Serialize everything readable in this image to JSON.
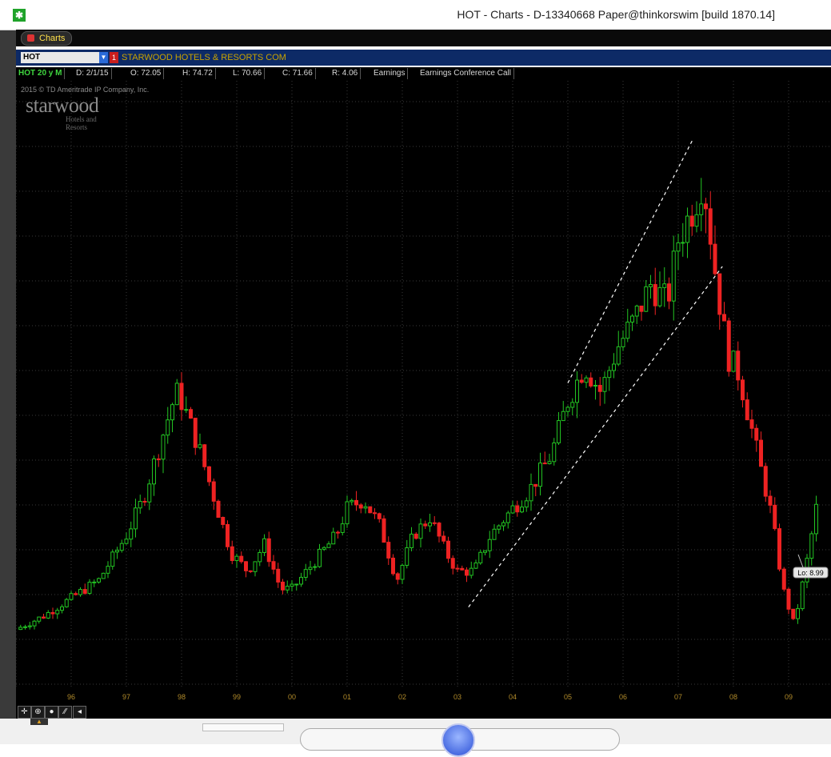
{
  "window": {
    "title": "HOT - Charts - D-13340668 Paper@thinkorswim [build 1870.14]"
  },
  "tab": {
    "label": "Charts"
  },
  "symbol": {
    "value": "HOT",
    "flag": "1",
    "company": "STARWOOD HOTELS & RESORTS COM"
  },
  "info": {
    "series": "HOT 20 y M",
    "date": "D: 2/1/15",
    "open": "O: 72.05",
    "high": "H: 74.72",
    "low": "L: 70.66",
    "close": "C: 71.66",
    "range": "R: 4.06",
    "earnings": "Earnings",
    "conference": "Earnings Conference Call"
  },
  "watermark": {
    "copyright": "2015 © TD Ameritrade IP Company, Inc.",
    "logo": "starwood",
    "logo_sub_1": "Hotels and",
    "logo_sub_2": "Resorts"
  },
  "colors": {
    "up": "#22c422",
    "down": "#ee2222",
    "axis_label": "#b08a2a",
    "grid": "#3a3a3a",
    "channel": "#ffffff"
  },
  "chart_data": {
    "type": "candlestick",
    "x_tick_labels": [
      "96",
      "97",
      "98",
      "99",
      "00",
      "01",
      "02",
      "03",
      "04",
      "05",
      "06",
      "07",
      "08",
      "09"
    ],
    "low_annotation": "Lo: 8.99",
    "ylim": [
      0,
      80
    ],
    "close_path": [
      [
        "1995.0",
        9.5
      ],
      [
        "1995.5",
        11
      ],
      [
        "1996.0",
        13
      ],
      [
        "1996.5",
        15
      ],
      [
        "1997.0",
        20
      ],
      [
        "1997.3",
        24
      ],
      [
        "1997.6",
        30
      ],
      [
        "1997.9",
        36
      ],
      [
        "1998.0",
        35
      ],
      [
        "1998.3",
        30
      ],
      [
        "1998.6",
        24
      ],
      [
        "1998.9",
        18
      ],
      [
        "1999.2",
        16
      ],
      [
        "1999.5",
        19
      ],
      [
        "1999.8",
        14
      ],
      [
        "2000.0",
        14
      ],
      [
        "2000.4",
        17
      ],
      [
        "2000.8",
        20
      ],
      [
        "2001.0",
        23
      ],
      [
        "2001.3",
        24
      ],
      [
        "2001.6",
        21
      ],
      [
        "2001.9",
        15
      ],
      [
        "2002.2",
        20
      ],
      [
        "2002.5",
        22
      ],
      [
        "2002.8",
        18
      ],
      [
        "2003.0",
        16
      ],
      [
        "2003.3",
        16
      ],
      [
        "2003.6",
        20
      ],
      [
        "2004.0",
        23
      ],
      [
        "2004.3",
        25
      ],
      [
        "2004.7",
        29
      ],
      [
        "2005.0",
        35
      ],
      [
        "2005.3",
        39
      ],
      [
        "2005.6",
        36
      ],
      [
        "2005.9",
        41
      ],
      [
        "2006.2",
        44
      ],
      [
        "2006.5",
        48
      ],
      [
        "2006.8",
        46
      ],
      [
        "2007.0",
        53
      ],
      [
        "2007.3",
        57
      ],
      [
        "2007.45",
        60
      ],
      [
        "2007.7",
        48
      ],
      [
        "2007.9",
        40
      ],
      [
        "2008.1",
        38
      ],
      [
        "2008.4",
        30
      ],
      [
        "2008.7",
        22
      ],
      [
        "2008.9",
        14
      ],
      [
        "2009.1",
        10
      ],
      [
        "2009.3",
        16
      ],
      [
        "2009.5",
        23
      ]
    ],
    "channel_lines": [
      {
        "from": [
          "2003.2",
          12
        ],
        "to": [
          "2007.8",
          50
        ]
      },
      {
        "from": [
          "2005.0",
          37
        ],
        "to": [
          "2007.25",
          64
        ]
      }
    ]
  }
}
